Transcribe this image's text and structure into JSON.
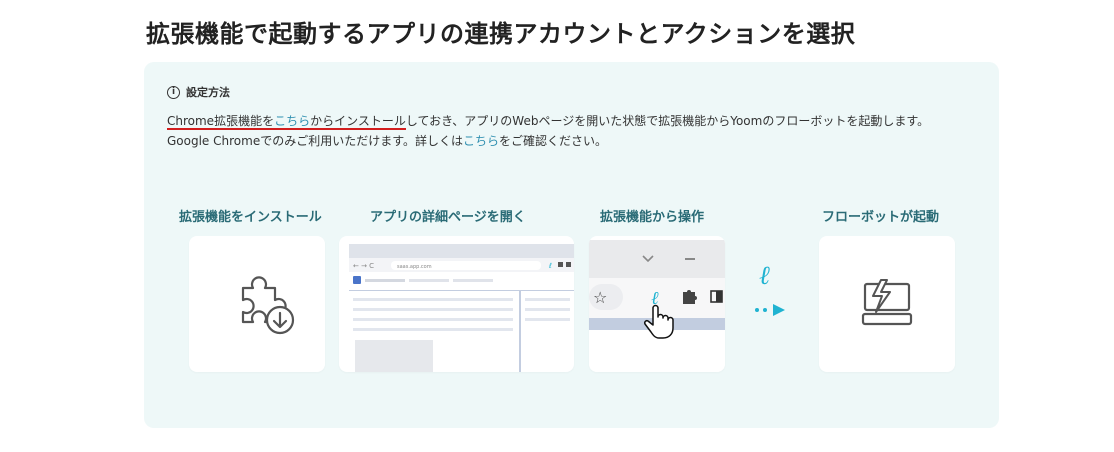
{
  "page_title": "拡張機能で起動するアプリの連携アカウントとアクションを選択",
  "info": {
    "icon": "info-icon",
    "heading": "設定方法",
    "line1_underlined_prefix": "Chrome拡張機能を",
    "line1_link": "こちら",
    "line1_underlined_suffix": "からインストール",
    "line1_rest": "しておき、アプリのWebページを開いた状態で拡張機能からYoomのフローボットを起動します。",
    "line2_prefix": "Google Chromeでのみご利用いただけます。詳しくは",
    "line2_link": "こちら",
    "line2_suffix": "をご確認ください。"
  },
  "steps": [
    {
      "label": "拡張機能をインストール",
      "icon": "puzzle-download-icon"
    },
    {
      "label": "アプリの詳細ページを開く",
      "icon": "browser-window-icon",
      "url_text": "saas.app.com"
    },
    {
      "label": "拡張機能から操作",
      "icon": "browser-toolbar-icon"
    },
    {
      "label": "フローボットが起動",
      "icon": "lightning-monitor-icon"
    }
  ],
  "colors": {
    "panel_bg": "#eef8f8",
    "step_label": "#2a6b76",
    "link": "#2f8fb0",
    "underline": "#d21e1e",
    "accent": "#1fb3d1"
  }
}
